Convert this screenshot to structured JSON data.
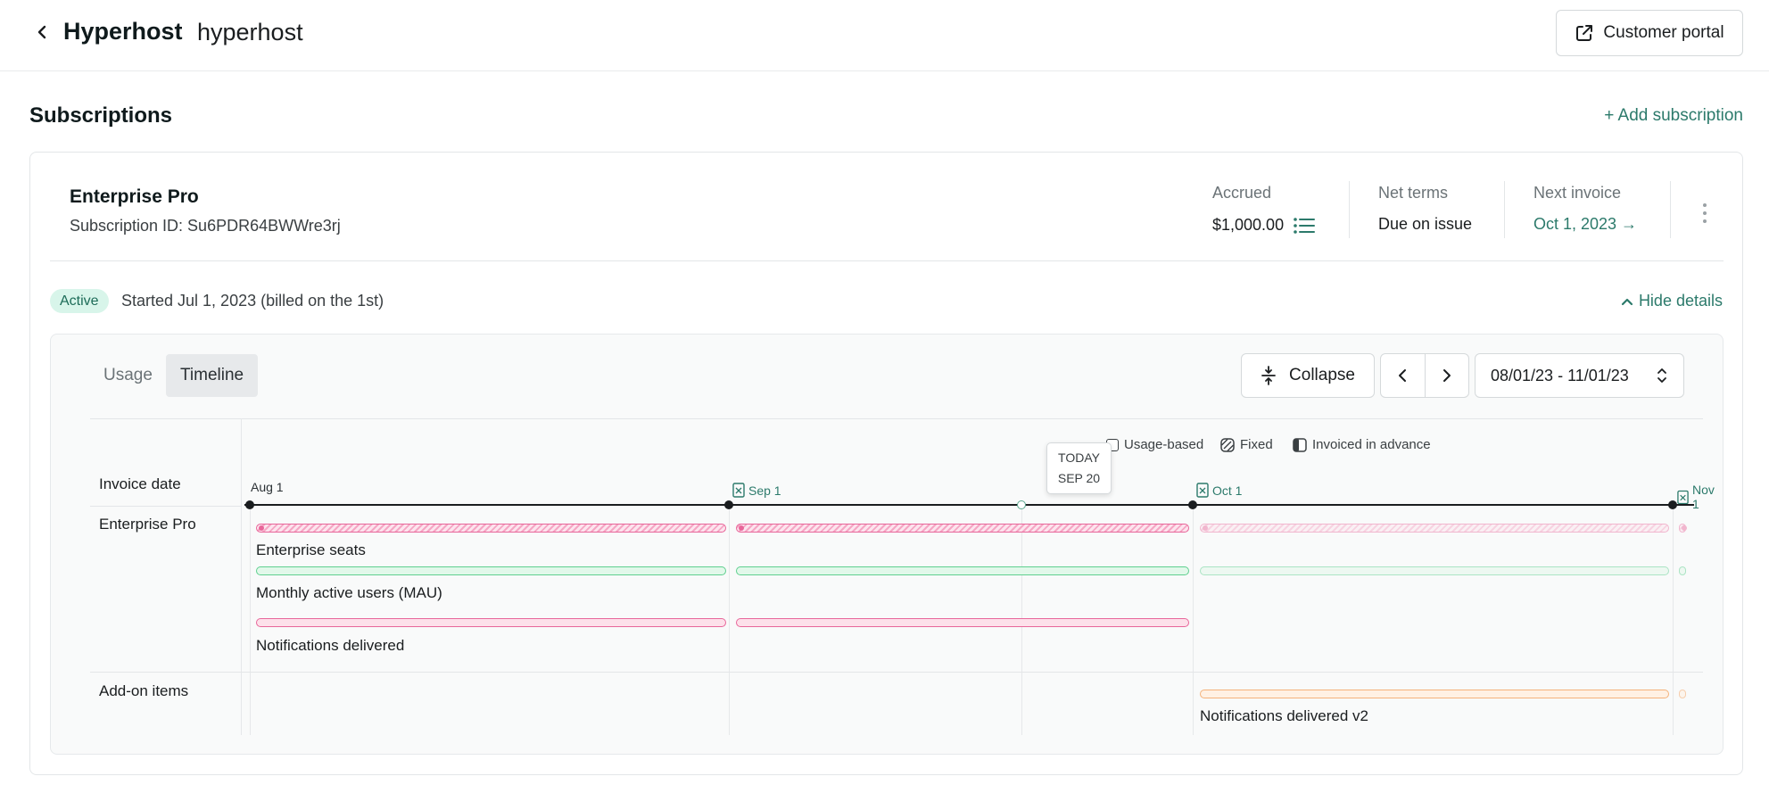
{
  "header": {
    "company_name": "Hyperhost",
    "company_slug": "hyperhost",
    "portal_button": "Customer portal"
  },
  "subscriptions": {
    "title": "Subscriptions",
    "add_link": "+ Add subscription"
  },
  "subscription": {
    "plan_name": "Enterprise Pro",
    "subscription_id": "Subscription ID: Su6PDR64BWWre3rj",
    "accrued_label": "Accrued",
    "accrued_value": "$1,000.00",
    "net_terms_label": "Net terms",
    "net_terms_value": "Due on issue",
    "next_invoice_label": "Next invoice",
    "next_invoice_value": "Oct 1, 2023 →",
    "status": "Active",
    "started_text": "Started Jul 1, 2023 (billed on the 1st)",
    "hide_details": "Hide details"
  },
  "timeline": {
    "tabs": [
      "Usage",
      "Timeline"
    ],
    "active_tab": "Timeline",
    "collapse_label": "Collapse",
    "date_range": "08/01/23 - 11/01/23",
    "legend": {
      "usage_based": "Usage-based",
      "fixed": "Fixed",
      "invoiced_in_advance": "Invoiced in advance"
    },
    "row_labels": {
      "invoice_date": "Invoice date",
      "plan": "Enterprise Pro",
      "addons": "Add-on items"
    },
    "dates": [
      "Aug 1",
      "Sep 1",
      "Oct 1",
      "Nov 1"
    ],
    "today": {
      "label": "TODAY",
      "date": "SEP 20"
    },
    "items": [
      {
        "name": "Enterprise seats",
        "kind": "fixed"
      },
      {
        "name": "Monthly active users (MAU)",
        "kind": "usage"
      },
      {
        "name": "Notifications delivered",
        "kind": "usage"
      },
      {
        "name": "Notifications delivered v2",
        "kind": "usage"
      }
    ]
  },
  "colors": {
    "accent": "#2c7a6b",
    "fixed_bar": "#e8669a",
    "usage_bar_green": "#5fd08f",
    "usage_bar_pink": "#e8669a",
    "addon_bar": "#f5b27a",
    "active_badge_bg": "#d8f5ea"
  }
}
